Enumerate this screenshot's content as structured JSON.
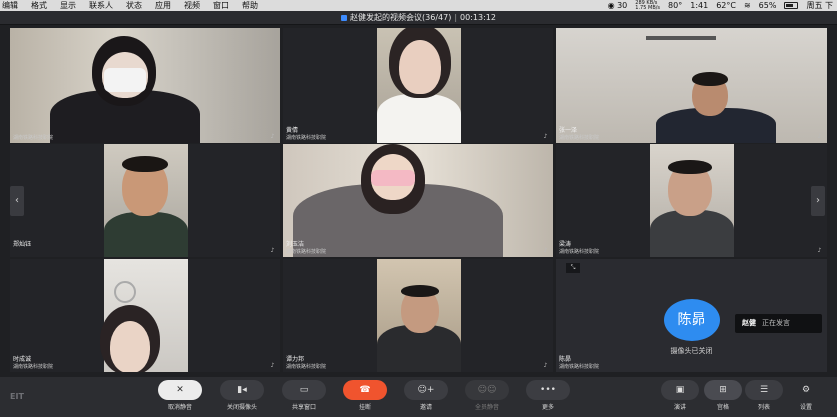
{
  "menubar": {
    "items": [
      "编辑",
      "格式",
      "显示",
      "联系人",
      "状态",
      "应用",
      "视频",
      "窗口",
      "帮助"
    ],
    "badge_count": "30",
    "net_up": "289 KB/s",
    "net_down": "1.75 MB/s",
    "temp": "80°",
    "clock1": "1:41",
    "cpu_temp": "62°C",
    "battery_pct": "65%",
    "weekday_time": "周五 下"
  },
  "title": {
    "meeting": "赵健发起的视频会议(36/47)",
    "duration": "00:13:12"
  },
  "tiles": [
    {
      "name": "",
      "org": "湖南铁路科技职院"
    },
    {
      "name": "黄倩",
      "org": "湖南铁路科技职院"
    },
    {
      "name": "张一泽",
      "org": "湖南铁路科技职院"
    },
    {
      "name": "郑灿钰",
      "org": ""
    },
    {
      "name": "刘玉洁",
      "org": "湖南铁路科技职院"
    },
    {
      "name": "梁涛",
      "org": "湖南铁路科技职院"
    },
    {
      "name": "时成诚",
      "org": "湖南铁路科技职院"
    },
    {
      "name": "谭力邦",
      "org": "湖南铁路科技职院"
    },
    {
      "name": "陈昴",
      "org": "湖南铁路科技职院",
      "avatar": "陈昴",
      "status": "摄像头已关闭"
    }
  ],
  "speaking": {
    "who": "赵健",
    "status": "正在发言"
  },
  "toolbar": {
    "mute": "取消静音",
    "camera": "关闭摄像头",
    "share": "共享窗口",
    "hangup": "挂断",
    "invite": "邀请",
    "mute_all": "全员静音",
    "more": "更多",
    "speaker_view": "演讲",
    "gallery_view": "宫格",
    "list_view": "列表",
    "settings": "设置"
  },
  "logo": "EIT",
  "colors": {
    "accent": "#2e8cf0",
    "hangup": "#f0542e"
  }
}
